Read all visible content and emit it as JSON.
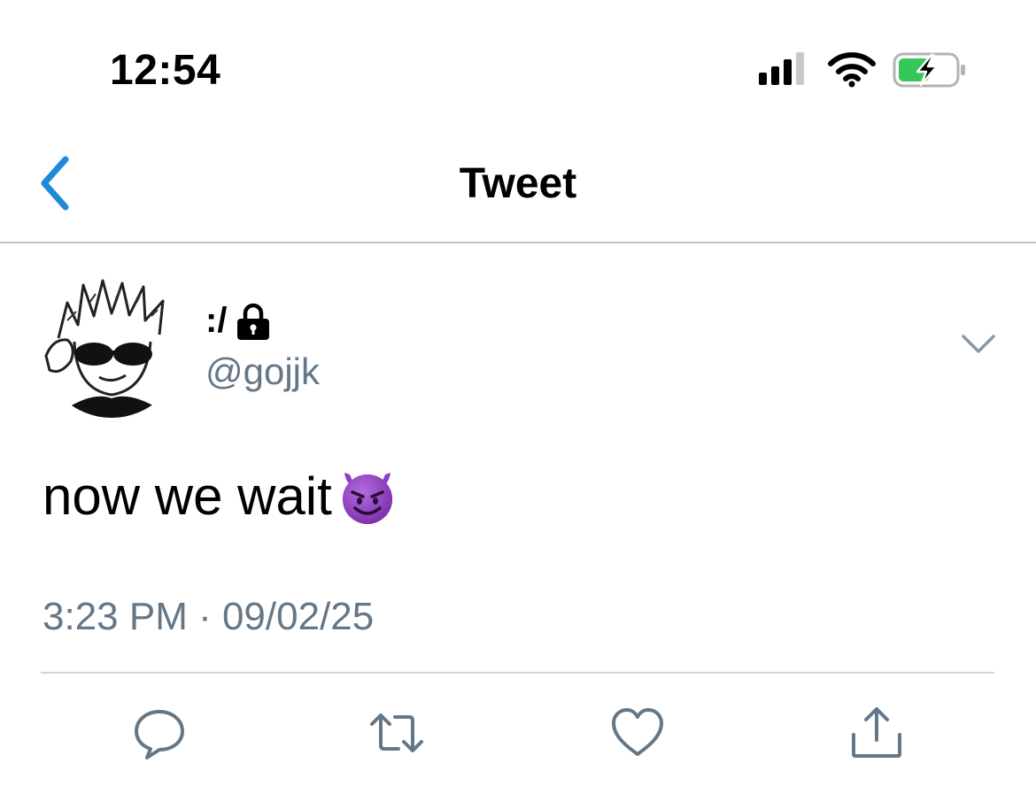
{
  "status_bar": {
    "time": "12:54",
    "icons": [
      "cellular-signal-icon",
      "wifi-icon",
      "battery-charging-icon"
    ],
    "battery_color": "#34c759"
  },
  "nav": {
    "title": "Tweet",
    "back_icon": "chevron-left-icon",
    "accent_color": "#1d8ad8"
  },
  "tweet": {
    "display_name": ":/",
    "protected_icon": "lock-icon",
    "handle": "@gojjk",
    "more_icon": "chevron-down-icon",
    "text": "now we wait",
    "emoji": "smiling-devil-emoji",
    "timestamp": "3:23 PM · 09/02/25"
  },
  "actions": [
    {
      "name": "reply",
      "icon": "reply-bubble-icon"
    },
    {
      "name": "retweet",
      "icon": "retweet-icon"
    },
    {
      "name": "like",
      "icon": "heart-icon"
    },
    {
      "name": "share",
      "icon": "share-icon"
    }
  ],
  "colors": {
    "secondary_text": "#657786",
    "icon_gray": "#657786",
    "emoji_purple": "#8e3fbf"
  }
}
